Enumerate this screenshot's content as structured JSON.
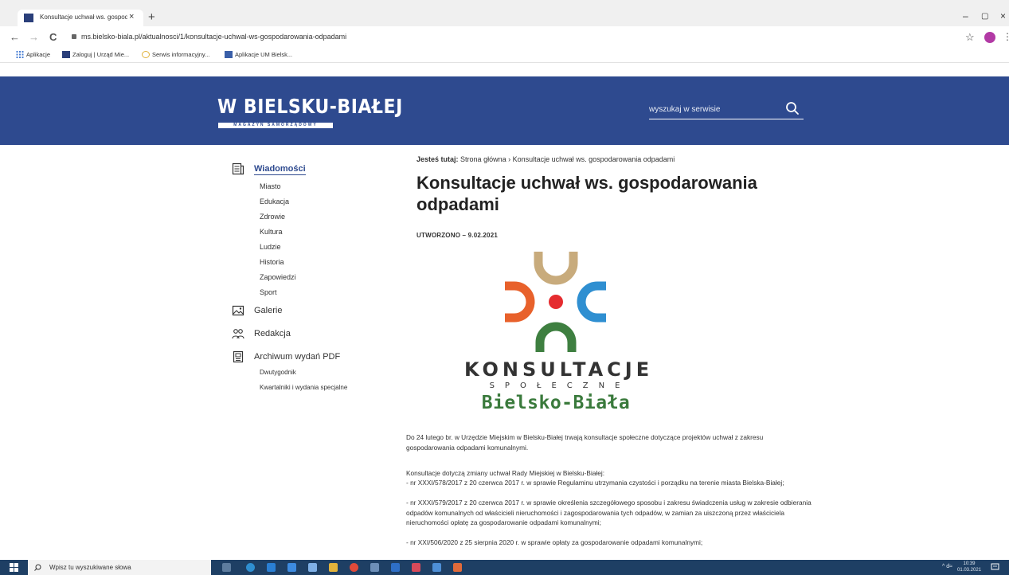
{
  "browser": {
    "tab_title": "Konsultacje uchwał ws. gospoda",
    "tab_close": "×",
    "new_tab": "+",
    "url": "ms.bielsko-biala.pl/aktualnosci/1/konsultacje-uchwal-ws-gospodarowania-odpadami",
    "minimize": "–",
    "maximize": "▢",
    "close": "×",
    "back": "←",
    "forward": "→",
    "reload": "C",
    "bookmark_star": "☆",
    "bookmarks": [
      {
        "label": "Aplikacje",
        "icon": "apps-grid-icon"
      },
      {
        "label": "Zaloguj | Urząd Mie...",
        "icon": "um-favicon-icon"
      },
      {
        "label": "Serwis informacyjny...",
        "icon": "info-favicon-icon"
      },
      {
        "label": "Aplikacje UM Bielsk...",
        "icon": "um-apps-favicon-icon"
      }
    ]
  },
  "header": {
    "logo": "W BIELSKU-BIAŁEJ",
    "logo_sub": "MAGAZYN SAMORZĄDOWY",
    "search_placeholder": "wyszukaj w serwisie"
  },
  "sidebar": {
    "sections": [
      {
        "label": "Wiadomości",
        "icon": "news-icon",
        "active": true,
        "children": [
          "Miasto",
          "Edukacja",
          "Zdrowie",
          "Kultura",
          "Ludzie",
          "Historia",
          "Zapowiedzi",
          "Sport"
        ]
      },
      {
        "label": "Galerie",
        "icon": "gallery-icon",
        "children": []
      },
      {
        "label": "Redakcja",
        "icon": "team-icon",
        "children": []
      },
      {
        "label": "Archiwum wydań PDF",
        "icon": "pdf-archive-icon",
        "children": [
          "Dwutygodnik",
          "Kwartalniki i wydania specjalne"
        ]
      }
    ]
  },
  "breadcrumb": {
    "prefix": "Jesteś tutaj:",
    "home": "Strona główna",
    "separator": "›",
    "current": "Konsultacje uchwał ws. gospodarowania odpadami"
  },
  "article": {
    "title": "Konsultacje uchwał ws. gospodarowania odpadami",
    "created": "UTWORZONO – 9.02.2021",
    "logo_word1": "KONSULTACJE",
    "logo_word2": "SPOŁECZNE",
    "logo_word3": "Bielsko-Biała",
    "logo_colors": {
      "top": "#c8ab7c",
      "left": "#e8612b",
      "dot": "#e52c2f",
      "right": "#2f8fd1",
      "bottom": "#3e7f40"
    },
    "p1": "Do 24 lutego br. w Urzędzie Miejskim w Bielsku-Białej trwają konsultacje społeczne dotyczące projektów uchwał z zakresu gospodarowania odpadami komunalnymi.",
    "p2_intro": "Konsultacje dotyczą zmiany uchwał Rady Miejskiej w Bielsku-Białej:",
    "p2_item1": "- nr XXXI/578/2017 z 20 czerwca 2017 r. w sprawie Regulaminu utrzymania czystości i porządku na terenie miasta Bielska-Białej;",
    "p2_item2": "- nr XXXI/579/2017 z 20 czerwca 2017 r. w sprawie określenia szczegółowego sposobu i zakresu świadczenia usług w zakresie odbierania odpadów komunalnych od właścicieli nieruchomości i zagospodarowania tych odpadów, w zamian za uiszczoną przez właściciela nieruchomości opłatę za gospodarowanie odpadami komunalnymi;",
    "p2_item3": "- nr XXI/506/2020 z 25 sierpnia 2020 r. w sprawie opłaty za gospodarowanie odpadami komunalnymi;"
  },
  "taskbar": {
    "search_placeholder": "Wpisz tu wyszukiwane słowa",
    "time": "10:39",
    "date": "01.03.2021",
    "tray": "^ d≈"
  },
  "colors": {
    "header": "#2e4a8f",
    "taskbar": "#1e3f64",
    "accent": "#2e4a8f"
  }
}
